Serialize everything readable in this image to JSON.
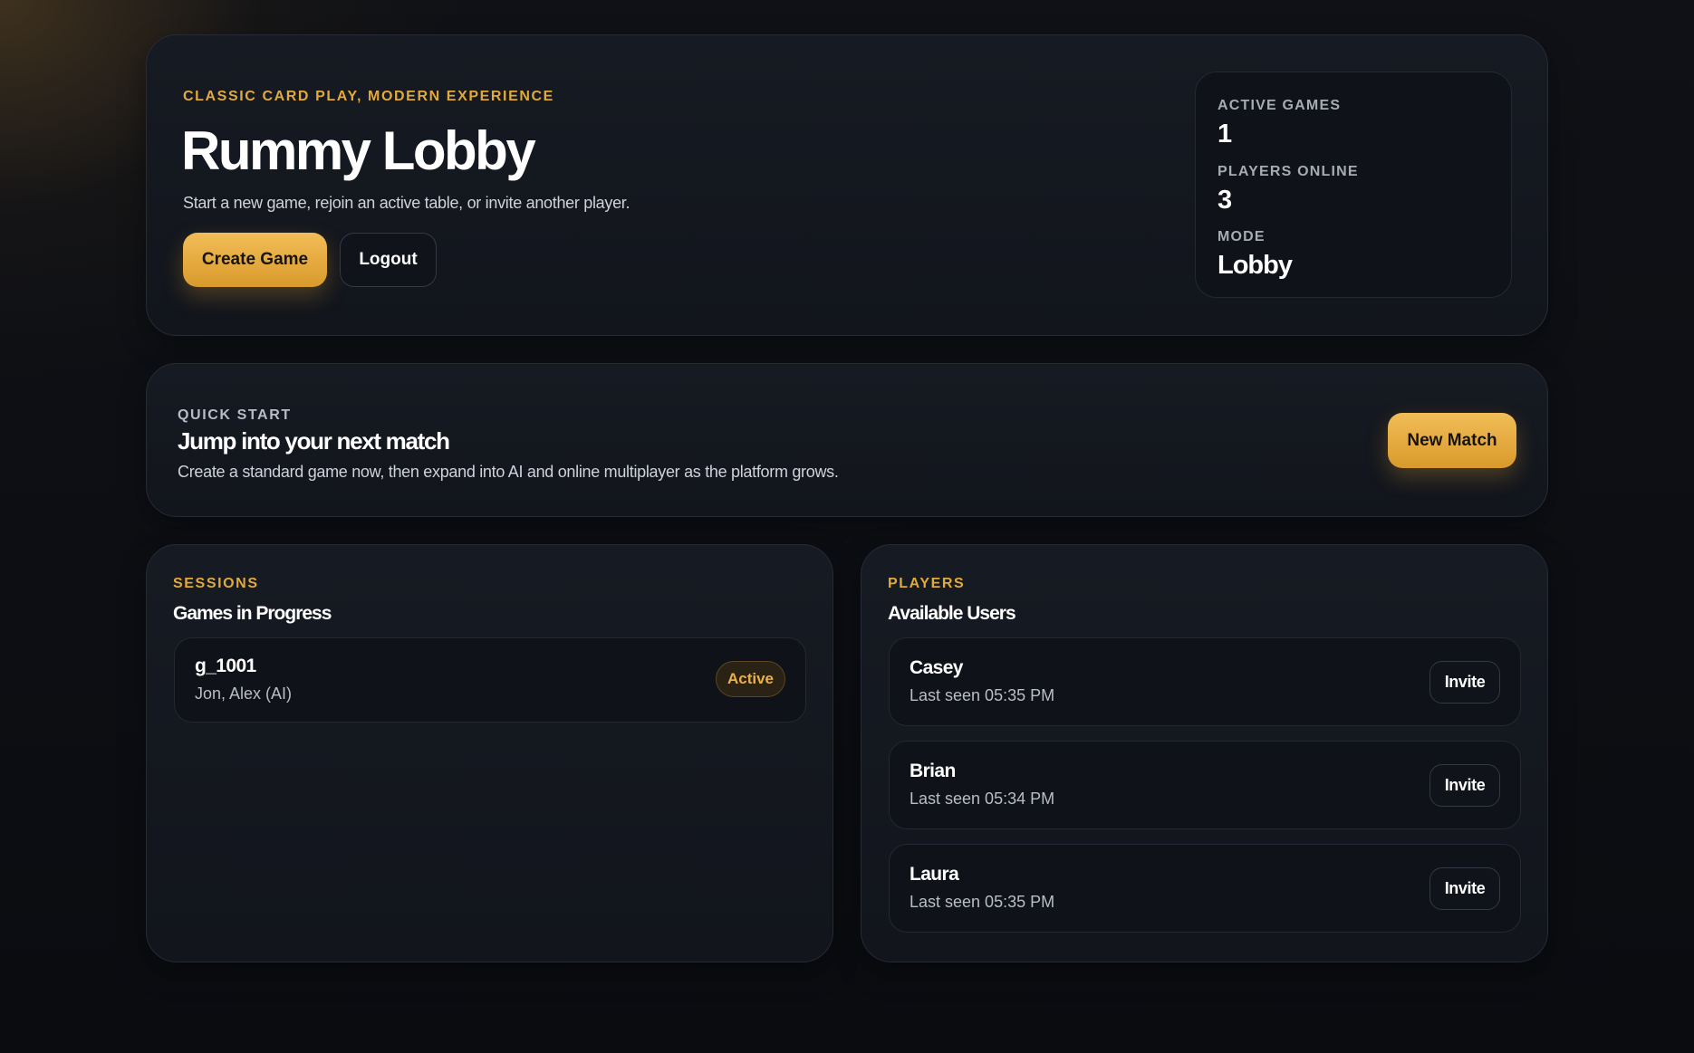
{
  "hero": {
    "eyebrow": "Classic card play, modern experience",
    "title": "Rummy Lobby",
    "subtitle": "Start a new game, rejoin an active table, or invite another player.",
    "create_label": "Create Game",
    "logout_label": "Logout"
  },
  "stats": {
    "active_games_label": "Active Games",
    "active_games_value": "1",
    "players_online_label": "Players Online",
    "players_online_value": "3",
    "mode_label": "Mode",
    "mode_value": "Lobby"
  },
  "quick_start": {
    "eyebrow": "Quick Start",
    "title": "Jump into your next match",
    "description": "Create a standard game now, then expand into AI and online multiplayer as the platform grows.",
    "button_label": "New Match"
  },
  "sessions": {
    "eyebrow": "Sessions",
    "title": "Games in Progress",
    "items": [
      {
        "id": "g_1001",
        "players": "Jon, Alex (AI)",
        "status": "Active"
      }
    ]
  },
  "players": {
    "eyebrow": "Players",
    "title": "Available Users",
    "invite_label": "Invite",
    "items": [
      {
        "name": "Casey",
        "last_seen": "Last seen 05:35 PM"
      },
      {
        "name": "Brian",
        "last_seen": "Last seen 05:34 PM"
      },
      {
        "name": "Laura",
        "last_seen": "Last seen 05:35 PM"
      }
    ]
  },
  "colors": {
    "accent_gold": "#e2a93b",
    "background": "#0c0e13",
    "card": "#151820"
  }
}
